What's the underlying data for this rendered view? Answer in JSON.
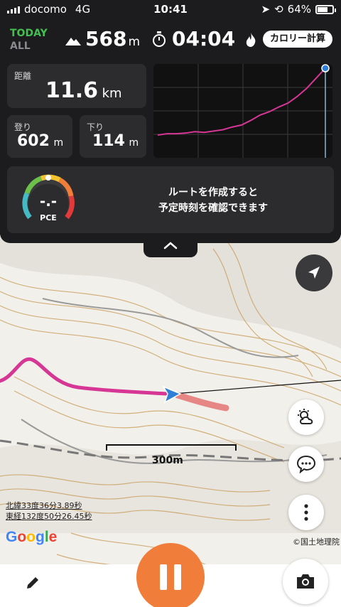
{
  "status_bar": {
    "carrier": "docomo",
    "network": "4G",
    "time": "10:41",
    "battery": "64%"
  },
  "summary": {
    "mode_active": "TODAY",
    "mode_inactive": "ALL",
    "elevation_value": "568",
    "elevation_unit": "m",
    "elapsed_time": "04:04",
    "calorie_button": "カロリー計算"
  },
  "stats": {
    "distance_label": "距離",
    "distance_value": "11.6",
    "distance_unit": "km",
    "ascent_label": "登り",
    "ascent_value": "602",
    "ascent_unit": "m",
    "descent_label": "下り",
    "descent_value": "114",
    "descent_unit": "m"
  },
  "pace": {
    "gauge_value": "-.-",
    "gauge_label": "PCE",
    "message_line1": "ルートを作成すると",
    "message_line2": "予定時刻を確認できます"
  },
  "map": {
    "scale_label": "300m",
    "latitude": "北緯33度36分3.89秒",
    "longitude": "東経132度50分26.45秒",
    "google_logo": "Google",
    "credit": "©国土地理院"
  },
  "icons": {
    "elevation": "mountain-icon",
    "timer": "stopwatch-icon",
    "calorie": "flame-icon",
    "expand": "chevron-up-icon",
    "locate": "location-arrow-icon",
    "weather": "weather-icon",
    "chat": "chat-icon",
    "more": "more-icon",
    "edit": "pencil-icon",
    "pause": "pause-icon",
    "camera": "camera-icon"
  },
  "colors": {
    "accent": "#f07d3a",
    "track": "#d63694",
    "today": "#43c04f",
    "panel": "#1c1c1e"
  },
  "chart_data": {
    "type": "line",
    "series": [
      {
        "values": [
          0,
          2,
          2,
          3,
          5,
          4,
          6,
          8,
          12,
          15,
          22,
          30,
          35,
          42,
          48,
          58,
          70,
          85,
          100
        ]
      }
    ]
  }
}
